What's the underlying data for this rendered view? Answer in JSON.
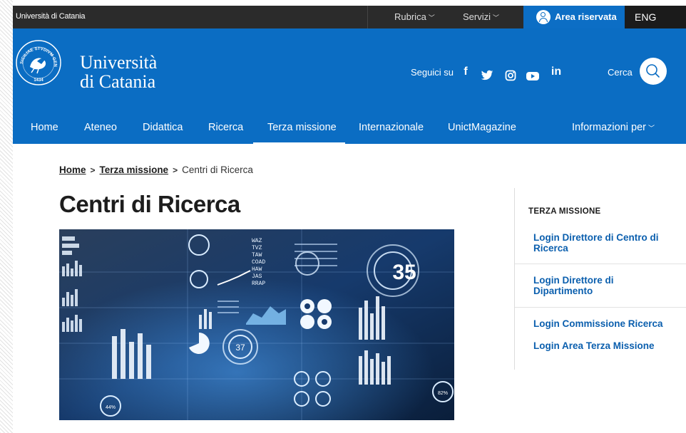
{
  "topbar": {
    "university": "Università di Catania",
    "rubrica": "Rubrica",
    "servizi": "Servizi",
    "area_riservata": "Area riservata",
    "eng": "ENG"
  },
  "header": {
    "logo_line1": "Università",
    "logo_line2": "di Catania",
    "seal_top": "SICILIAE STVDIVM GENERALE",
    "seal_year": "1434",
    "follow_label": "Seguici su",
    "social_icons": [
      "facebook-icon",
      "twitter-icon",
      "instagram-icon",
      "youtube-icon",
      "linkedin-icon"
    ],
    "search_label": "Cerca"
  },
  "nav": {
    "items": [
      "Home",
      "Ateneo",
      "Didattica",
      "Ricerca",
      "Terza missione",
      "Internazionale",
      "UnictMagazine"
    ],
    "info": "Informazioni per",
    "active": "Terza missione"
  },
  "breadcrumb": {
    "home": "Home",
    "section": "Terza missione",
    "current": "Centri di Ricerca"
  },
  "page": {
    "title": "Centri di Ricerca",
    "hero_texts": {
      "t35": "35",
      "t37": "37",
      "t44": "44%",
      "t82": "82%",
      "codes": "WAZ\nTVZ\nTAW\nCOAD\nHAW\nJAS\nRRAP"
    }
  },
  "sidebar": {
    "heading": "TERZA MISSIONE",
    "links": [
      "Login Direttore di Centro di Ricerca",
      "Login Direttore di Dipartimento",
      "Login Commissione Ricerca",
      "Login Area Terza Missione"
    ]
  },
  "colors": {
    "brand_blue": "#0b6dc3",
    "topbar": "#2b2b2b",
    "link_blue": "#0b5fae"
  }
}
